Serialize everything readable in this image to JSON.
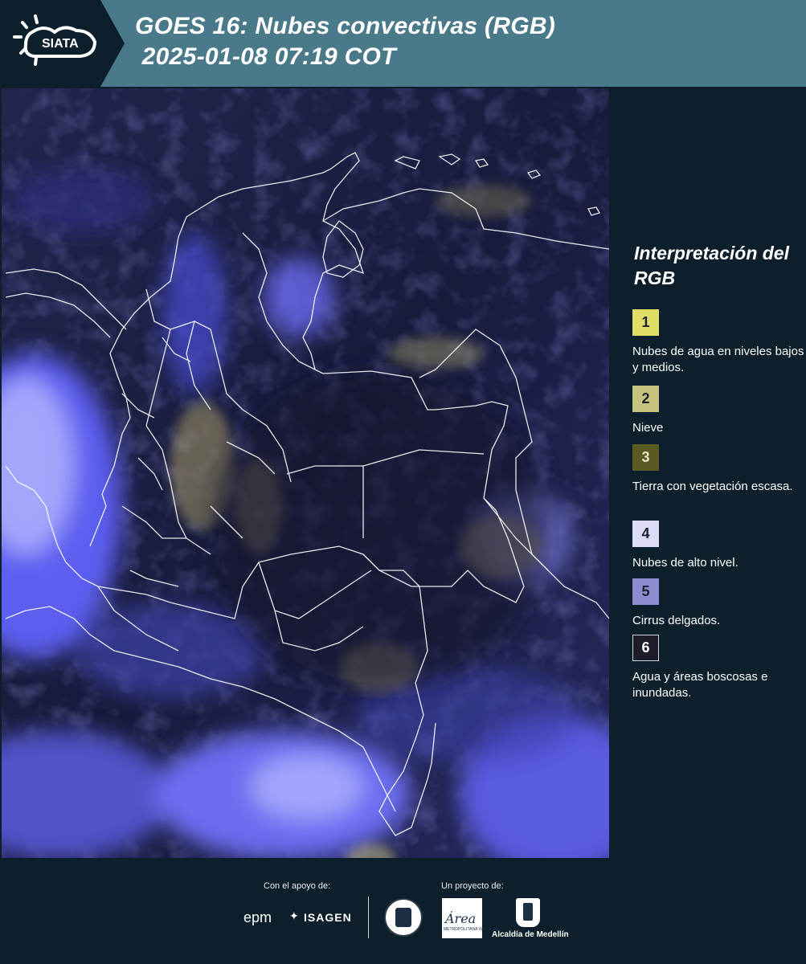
{
  "header": {
    "logo_text": "SIATA",
    "title_line1": "GOES 16: Nubes convectivas (RGB)",
    "title_line2": " 2025-01-08 07:19 COT"
  },
  "legend": {
    "title": "Interpretación del RGB",
    "items": [
      {
        "num": "1",
        "color": "#e0de64",
        "text": "Nubes de agua en niveles bajos y medios."
      },
      {
        "num": "2",
        "color": "#c4c27c",
        "text": "Nieve"
      },
      {
        "num": "3",
        "color": "#5a5a22",
        "text": "Tierra con vegetación escasa."
      },
      {
        "num": "4",
        "color": "#dcdcf8",
        "text": "Nubes de alto nivel."
      },
      {
        "num": "5",
        "color": "#8c8cd2",
        "text": "Cirrus delgados."
      },
      {
        "num": "6",
        "color": "#1d1d2a",
        "text": "Agua y áreas boscosas e inundadas."
      }
    ]
  },
  "footer": {
    "support_label": "Con el apoyo de:",
    "project_label": "Un proyecto de:",
    "partner1": "epm",
    "partner2": "ISAGEN",
    "area_name": "Área",
    "area_sub": "METROPOLITANA Valle de Aburrá",
    "alcaldia": "Alcaldía de Medellín"
  },
  "colors": {
    "header_bg": "#4a7a8a",
    "panel_bg": "#0c1f2b",
    "map_base": "#1b1f45",
    "cloud_high": "#5a5ae6",
    "cloud_low": "#b4aa6e"
  }
}
